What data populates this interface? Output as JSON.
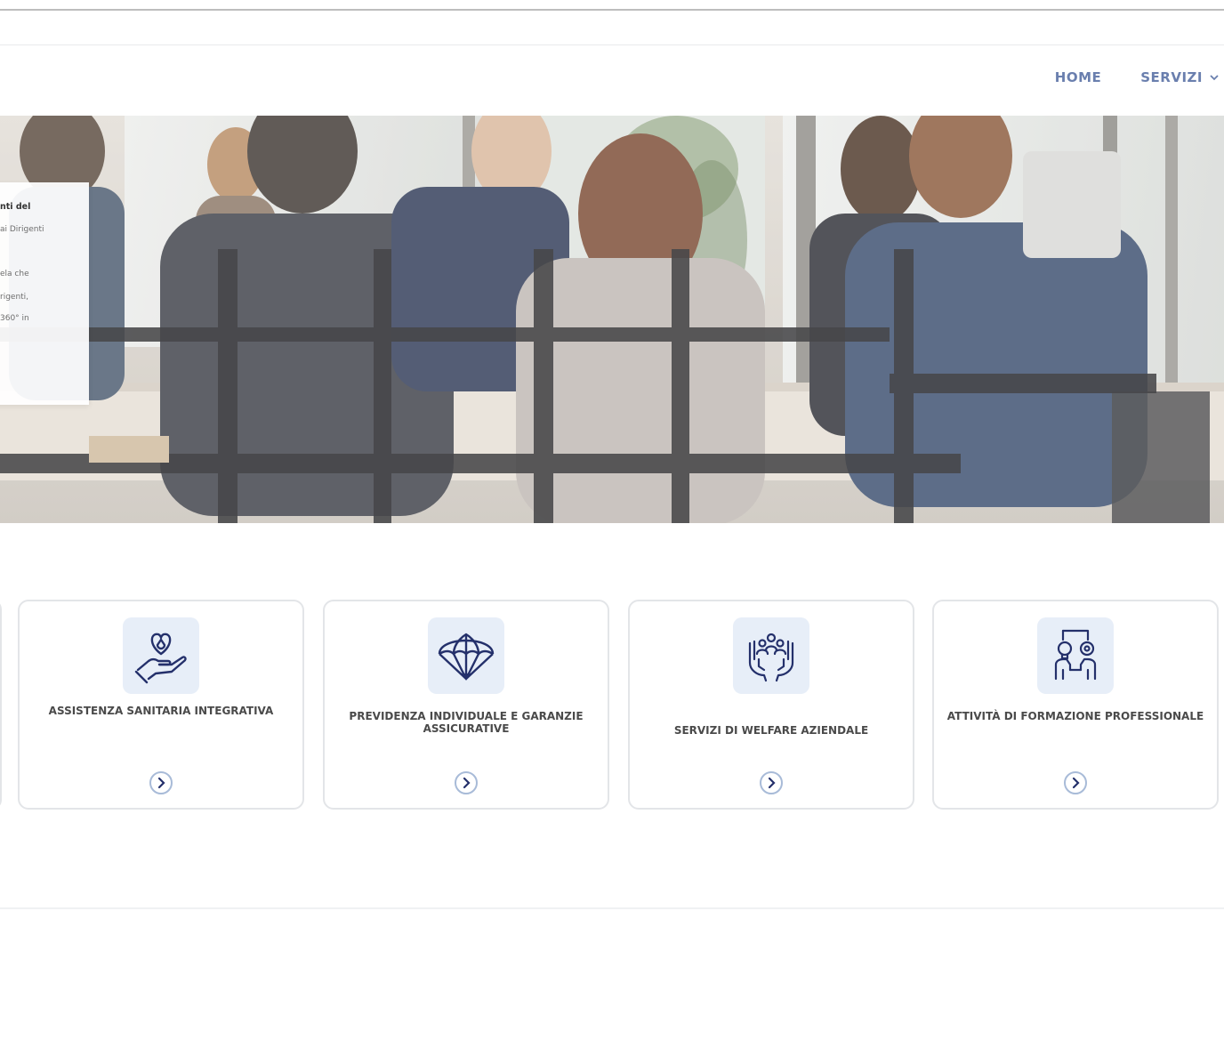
{
  "nav": {
    "home": "HOME",
    "servizi": "SERVIZI"
  },
  "hero_card": {
    "lines": [
      "nti del",
      "ai Dirigenti",
      "",
      "ela che",
      "rigenti,",
      "360° in"
    ]
  },
  "cards": [
    {
      "title": "ASSISTENZA SANITARIA INTEGRATIVA",
      "icon": "heart-hand-icon"
    },
    {
      "title": "PREVIDENZA INDIVIDUALE E GARANZIE ASSICURATIVE",
      "icon": "parachute-icon"
    },
    {
      "title": "SERVIZI DI WELFARE AZIENDALE",
      "icon": "hands-people-icon"
    },
    {
      "title": "ATTIVITÀ DI FORMAZIONE PROFESSIONALE",
      "icon": "training-icon"
    }
  ],
  "colors": {
    "nav": "#6a7fae",
    "icon_bg": "#e7eef8",
    "icon_stroke": "#24306b",
    "card_border": "#e3e5e8"
  }
}
